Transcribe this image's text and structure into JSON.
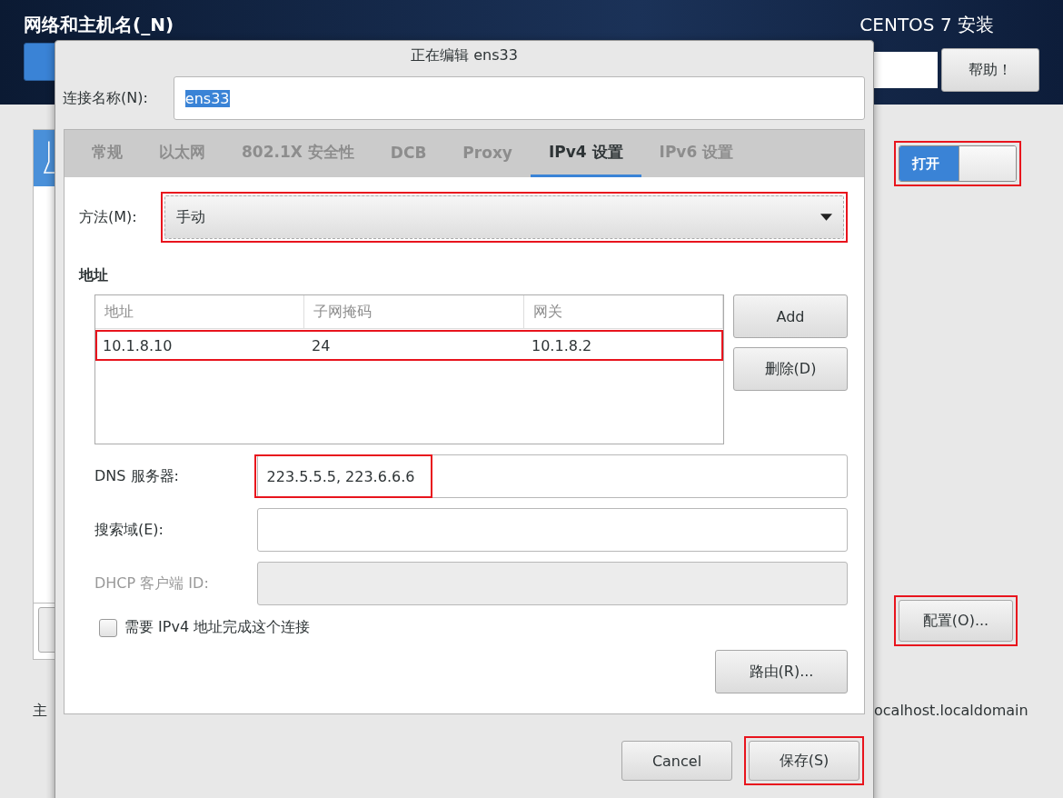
{
  "header": {
    "title": "网络和主机名(_N)",
    "product": "CENTOS 7 安装",
    "help_button": "帮助！"
  },
  "background": {
    "switch": {
      "label": "打开",
      "on": true,
      "highlighted": true
    },
    "configure_button": {
      "label": "配置(O)...",
      "highlighted": true
    },
    "hostname_label": "主",
    "hostname_value": "ocalhost.localdomain"
  },
  "dialog": {
    "title": "正在编辑 ens33",
    "name_label": "连接名称(N):",
    "name_value": "ens33",
    "name_text_selected": true,
    "tabs": [
      {
        "label": "常规",
        "selected": false
      },
      {
        "label": "以太网",
        "selected": false
      },
      {
        "label": "802.1X 安全性",
        "selected": false
      },
      {
        "label": "DCB",
        "selected": false
      },
      {
        "label": "Proxy",
        "selected": false
      },
      {
        "label": "IPv4 设置",
        "selected": true
      },
      {
        "label": "IPv6 设置",
        "selected": false
      }
    ],
    "method": {
      "label": "方法(M):",
      "value": "手动",
      "highlighted": true
    },
    "address_heading": "地址",
    "table": {
      "columns": [
        "地址",
        "子网掩码",
        "网关"
      ],
      "rows": [
        {
          "cells": [
            "10.1.8.10",
            "24",
            "10.1.8.2"
          ],
          "highlighted": true
        }
      ]
    },
    "add_button": "Add",
    "delete_button": "删除(D)",
    "fields": [
      {
        "label": "DNS 服务器:",
        "value": "223.5.5.5, 223.6.6.6",
        "disabled": false,
        "highlighted": true
      },
      {
        "label": "搜索域(E):",
        "disabled": false
      },
      {
        "label": "DHCP 客户端 ID:",
        "disabled": true
      }
    ],
    "checkbox": {
      "label": "需要 IPv4 地址完成这个连接",
      "checked": false
    },
    "routes_button": "路由(R)...",
    "cancel_button": {
      "label": "Cancel",
      "highlighted": false
    },
    "save_button": {
      "label": "保存(S)",
      "highlighted": true
    }
  }
}
